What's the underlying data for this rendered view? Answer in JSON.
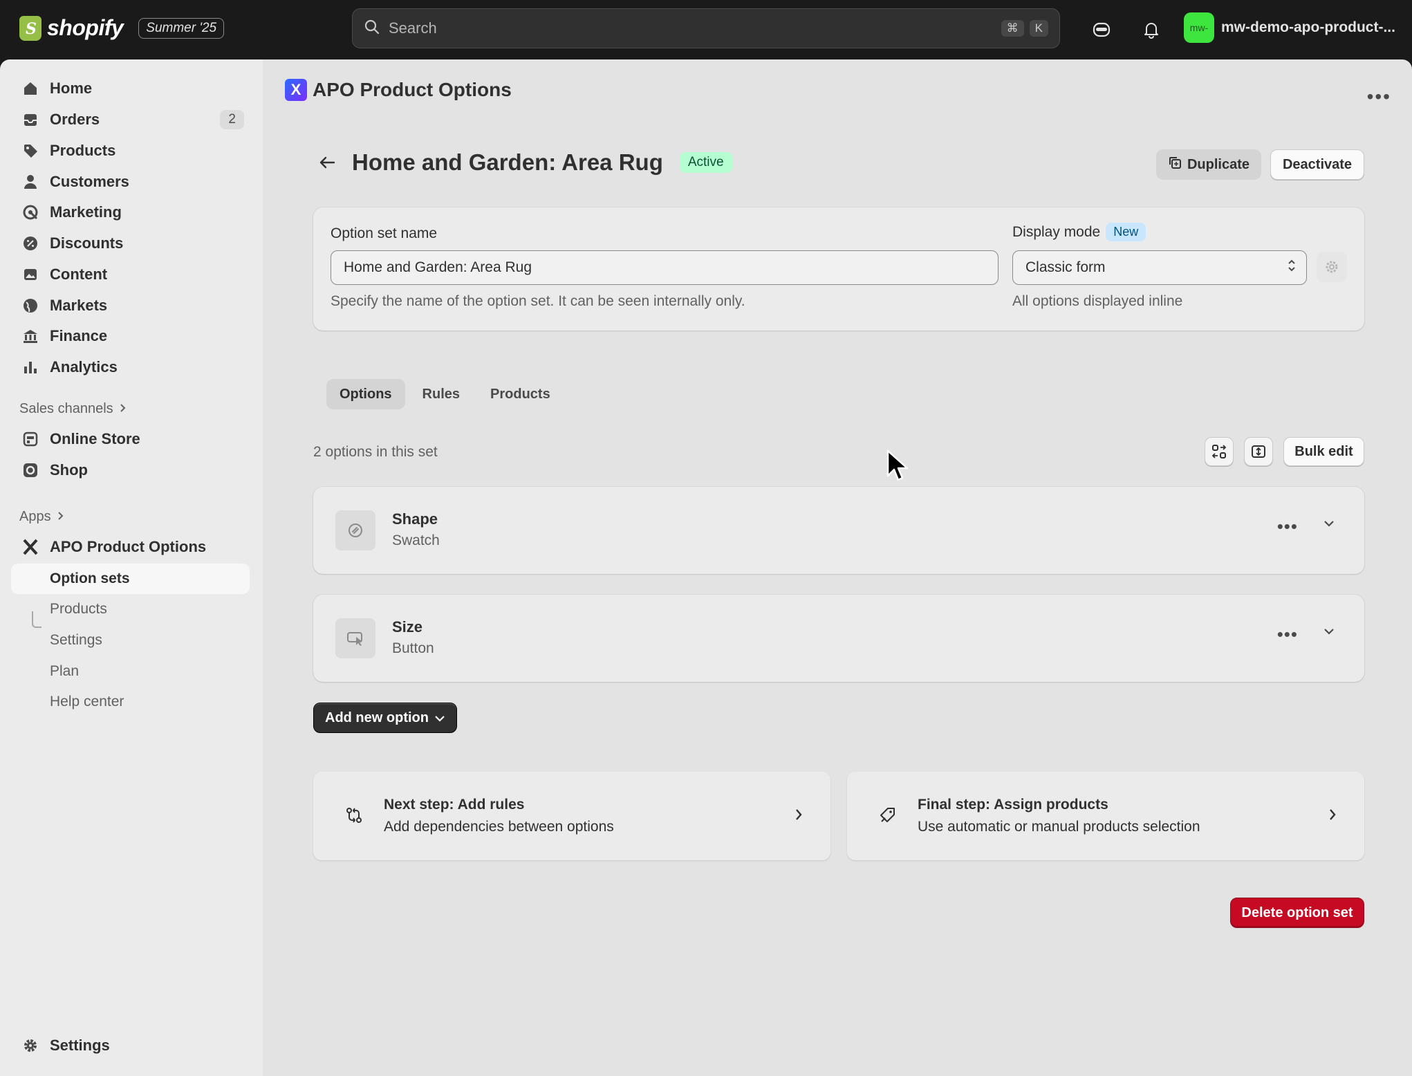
{
  "topbar": {
    "brand": "shopify",
    "edition": "Summer '25",
    "search_placeholder": "Search",
    "shortcut_cmd": "⌘",
    "shortcut_key": "K",
    "store_avatar": "mw-",
    "store_name": "mw-demo-apo-product-..."
  },
  "sidebar": {
    "items": [
      {
        "label": "Home",
        "icon": "home-icon"
      },
      {
        "label": "Orders",
        "icon": "orders-icon",
        "count": "2"
      },
      {
        "label": "Products",
        "icon": "tag-icon"
      },
      {
        "label": "Customers",
        "icon": "person-icon"
      },
      {
        "label": "Marketing",
        "icon": "target-icon"
      },
      {
        "label": "Discounts",
        "icon": "discount-icon"
      },
      {
        "label": "Content",
        "icon": "image-icon"
      },
      {
        "label": "Markets",
        "icon": "globe-icon"
      },
      {
        "label": "Finance",
        "icon": "bank-icon"
      },
      {
        "label": "Analytics",
        "icon": "chart-icon"
      }
    ],
    "sales_channels_label": "Sales channels",
    "channels": [
      {
        "label": "Online Store",
        "icon": "store-icon"
      },
      {
        "label": "Shop",
        "icon": "shop-icon"
      }
    ],
    "apps_label": "Apps",
    "app_name": "APO Product Options",
    "app_subitems": [
      "Option sets",
      "Products",
      "Settings",
      "Plan",
      "Help center"
    ],
    "settings_label": "Settings"
  },
  "main": {
    "app_title": "APO Product Options",
    "page_title": "Home and Garden: Area Rug",
    "status": "Active",
    "duplicate_label": "Duplicate",
    "deactivate_label": "Deactivate",
    "form": {
      "name_label": "Option set name",
      "name_value": "Home and Garden: Area Rug",
      "name_help": "Specify the name of the option set. It can be seen internally only.",
      "display_mode_label": "Display mode",
      "display_mode_badge": "New",
      "display_mode_value": "Classic form",
      "display_mode_help": "All options displayed inline"
    },
    "tabs": [
      "Options",
      "Rules",
      "Products"
    ],
    "options_count_text": "2 options in this set",
    "bulk_edit_label": "Bulk edit",
    "options": [
      {
        "name": "Shape",
        "type": "Swatch",
        "icon": "swatch-icon"
      },
      {
        "name": "Size",
        "type": "Button",
        "icon": "cursor-button-icon"
      }
    ],
    "add_option_label": "Add new option",
    "steps": [
      {
        "title": "Next step: Add rules",
        "desc": "Add dependencies between options",
        "icon": "rules-icon"
      },
      {
        "title": "Final step: Assign products",
        "desc": "Use automatic or manual products selection",
        "icon": "product-tag-icon"
      }
    ],
    "delete_label": "Delete option set"
  },
  "colors": {
    "topbar_bg": "#1a1a1a",
    "sidebar_bg": "#ebebeb",
    "main_bg": "#e3e3e3",
    "active_badge_bg": "#b4fed2",
    "new_badge_bg": "#c9e6ff",
    "critical": "#c70a24",
    "store_avatar_bg": "#3ee53e"
  }
}
